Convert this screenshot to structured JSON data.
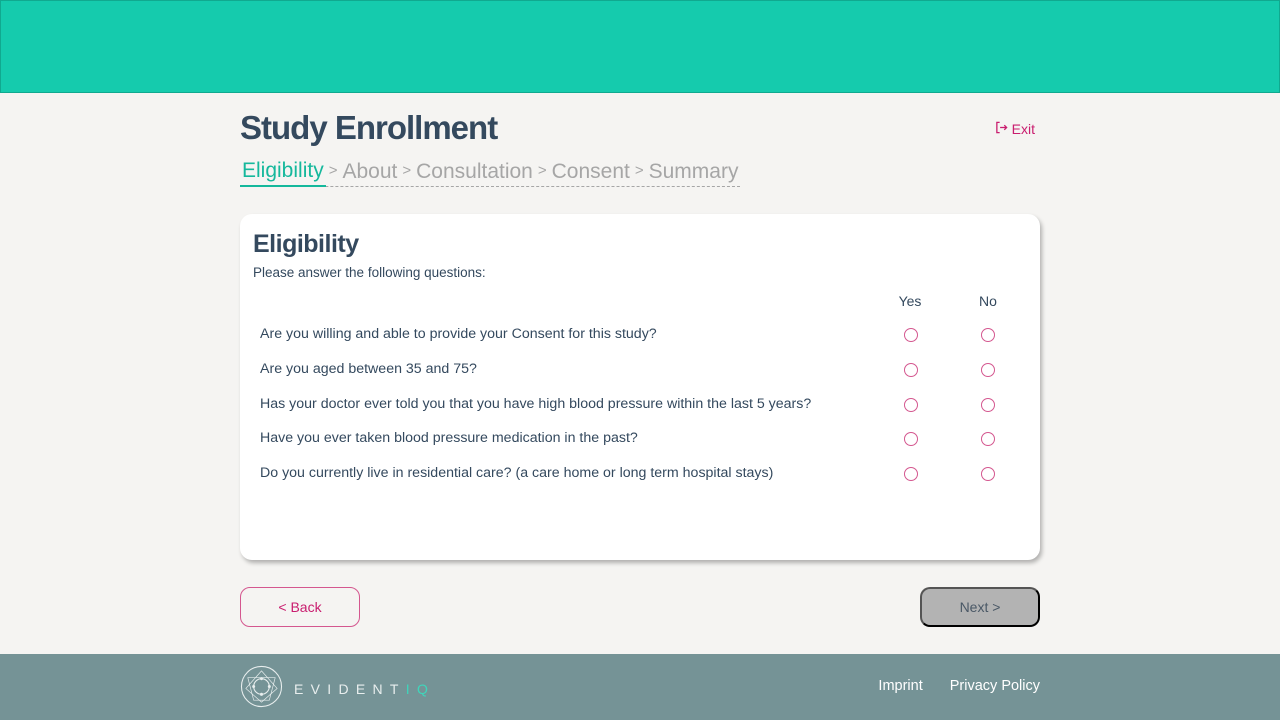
{
  "header": {
    "banner_color": "#15cbad"
  },
  "page": {
    "title": "Study Enrollment",
    "exit_label": "Exit",
    "exit_icon": "sign-out-icon"
  },
  "stepper": {
    "steps": [
      {
        "label": "Eligibility",
        "active": true
      },
      {
        "label": "About",
        "active": false
      },
      {
        "label": "Consultation",
        "active": false
      },
      {
        "label": "Consent",
        "active": false
      },
      {
        "label": "Summary",
        "active": false
      }
    ],
    "separator": ">"
  },
  "card": {
    "title": "Eligibility",
    "subtitle": "Please answer the following questions:",
    "columns": {
      "yes": "Yes",
      "no": "No"
    },
    "questions": [
      {
        "text": "Are you willing and able to provide your Consent for this study?",
        "answer": null
      },
      {
        "text": "Are you aged between 35 and 75?",
        "answer": null
      },
      {
        "text": "Has your doctor ever told you that you have high blood pressure within the last 5 years?",
        "answer": null
      },
      {
        "text": "Have you ever taken blood pressure medication in the past?",
        "answer": null
      },
      {
        "text": "Do you currently live in residential care? (a care home or long term hospital stays)",
        "answer": null
      }
    ]
  },
  "nav": {
    "back_label": "< Back",
    "next_label": "Next >",
    "next_disabled": true
  },
  "footer": {
    "brand_main": "EVIDENT",
    "brand_accent": "IQ",
    "links": [
      "Imprint",
      "Privacy Policy"
    ]
  },
  "colors": {
    "accent_teal": "#15cbad",
    "accent_pink": "#c91d6f",
    "text_dark": "#34495e",
    "footer_bg": "#759396"
  }
}
